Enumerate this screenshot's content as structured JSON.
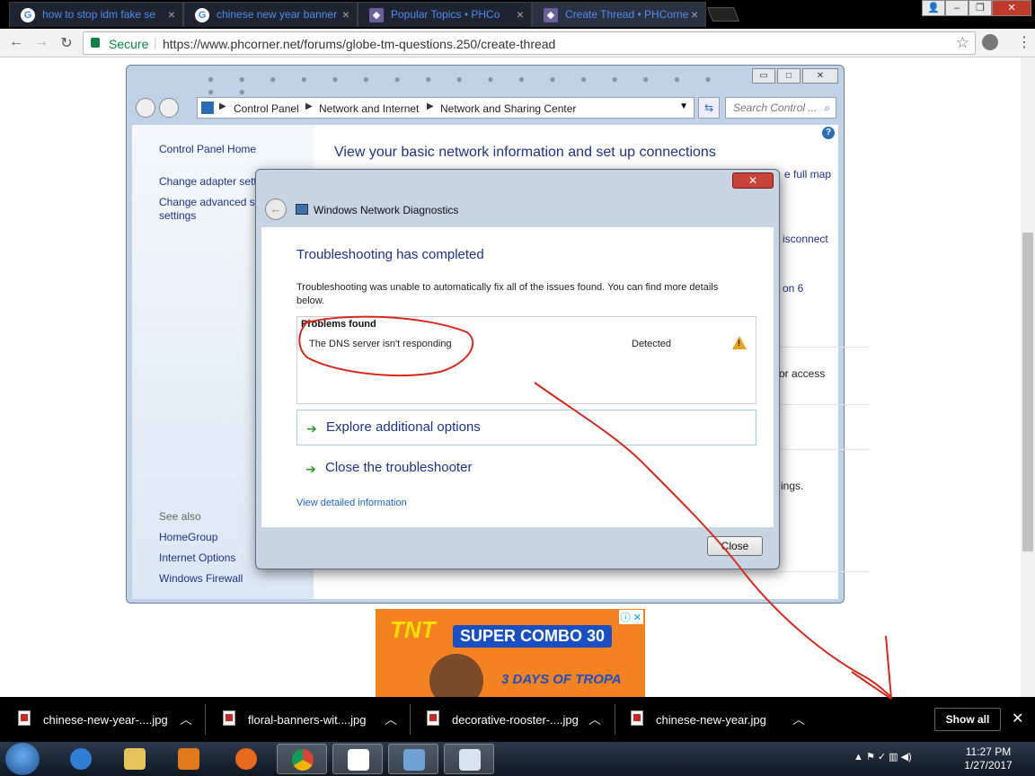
{
  "browser": {
    "tabs": [
      {
        "title": "how to stop idm fake se",
        "icon": "google-icon"
      },
      {
        "title": "chinese new year banner",
        "icon": "google-icon"
      },
      {
        "title": "Popular Topics • PHCo",
        "icon": "phcorner-icon"
      },
      {
        "title": "Create Thread • PHCorne",
        "icon": "phcorner-icon"
      }
    ],
    "secure_label": "Secure",
    "url": "https://www.phcorner.net/forums/globe-tm-questions.250/create-thread"
  },
  "explorer": {
    "breadcrumbs": [
      "Control Panel",
      "Network and Internet",
      "Network and Sharing Center"
    ],
    "search_placeholder": "Search Control ...",
    "sidebar": {
      "home": "Control Panel Home",
      "adapter": "Change adapter sett",
      "advanced_1": "Change advanced sh",
      "advanced_2": "settings",
      "see_also": "See also",
      "links": [
        "HomeGroup",
        "Internet Options",
        "Windows Firewall"
      ]
    },
    "main_title": "View your basic network information and set up connections",
    "right_fragments": [
      "e full map",
      "isconnect",
      "on 6",
      "or access",
      "ings."
    ]
  },
  "dialog": {
    "title": "Windows Network Diagnostics",
    "heading": "Troubleshooting has completed",
    "description": "Troubleshooting was unable to automatically fix all of the issues found. You can find more details below.",
    "problems_header": "Problems found",
    "problem": {
      "name": "The DNS server isn't responding",
      "status": "Detected"
    },
    "options": [
      "Explore additional options",
      "Close the troubleshooter"
    ],
    "detail_link": "View detailed information",
    "close_button": "Close"
  },
  "ad": {
    "brand": "TNT",
    "headline": "SUPER COMBO 30",
    "tagline": "3 DAYS OF TROPA"
  },
  "downloads": {
    "files": [
      "chinese-new-year-....jpg",
      "floral-banners-wit....jpg",
      "decorative-rooster-....jpg",
      "chinese-new-year.jpg"
    ],
    "show_all": "Show all"
  },
  "taskbar": {
    "time": "11:27 PM",
    "date": "1/27/2017"
  },
  "colors": {
    "link_blue": "#1e3287",
    "annotation_red": "#d42a1e",
    "secure_green": "#0b8043"
  }
}
